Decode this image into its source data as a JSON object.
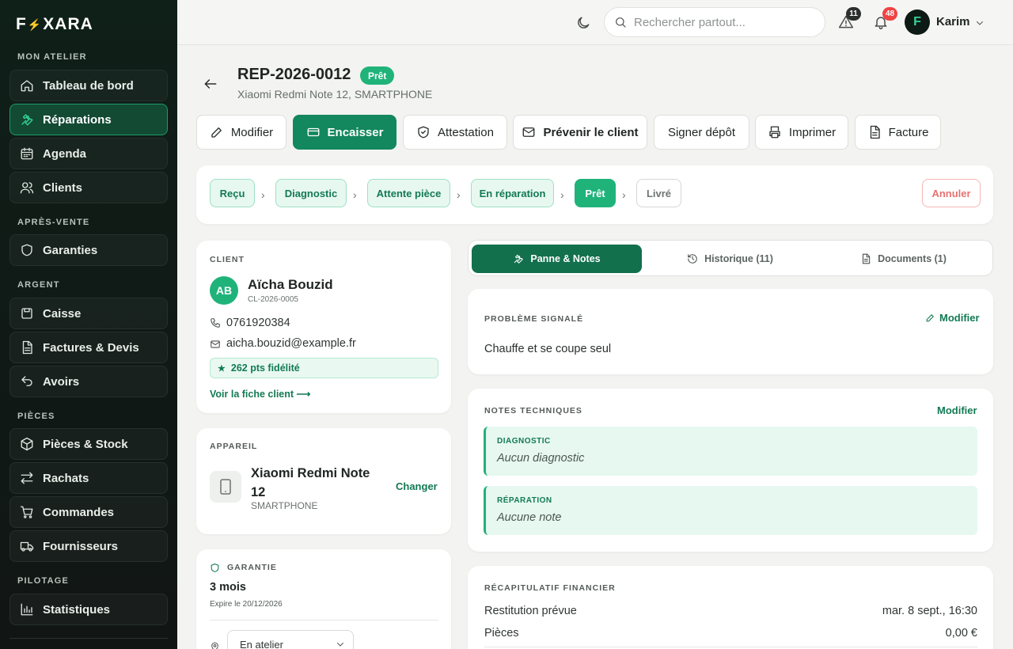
{
  "brand": {
    "logo_left": "F",
    "logo_bolt": "⚡",
    "logo_right": "XARA",
    "accent": "#1fb37a",
    "dark_accent": "#13875e"
  },
  "sidebar": {
    "sections": {
      "atelier": "MON ATELIER",
      "apres": "APRÈS-VENTE",
      "argent": "ARGENT",
      "pieces": "PIÈCES",
      "pilotage": "PILOTAGE"
    },
    "items": [
      {
        "label": "Tableau de bord",
        "icon": "home-icon"
      },
      {
        "label": "Réparations",
        "icon": "wrench-icon",
        "active": true
      },
      {
        "label": "Agenda",
        "icon": "calendar-icon"
      },
      {
        "label": "Clients",
        "icon": "users-icon"
      },
      {
        "label": "Garanties",
        "icon": "shield-icon"
      },
      {
        "label": "Caisse",
        "icon": "register-icon"
      },
      {
        "label": "Factures & Devis",
        "icon": "document-icon"
      },
      {
        "label": "Avoirs",
        "icon": "undo-icon"
      },
      {
        "label": "Pièces & Stock",
        "icon": "box-icon"
      },
      {
        "label": "Rachats",
        "icon": "swap-icon"
      },
      {
        "label": "Commandes",
        "icon": "cart-icon"
      },
      {
        "label": "Fournisseurs",
        "icon": "truck-icon"
      },
      {
        "label": "Statistiques",
        "icon": "bar-chart-icon"
      }
    ]
  },
  "topbar": {
    "search_placeholder": "Rechercher partout...",
    "alerts_count": "11",
    "notifications_count": "48",
    "user_initial": "F",
    "user_name": "Karim"
  },
  "repair": {
    "reference": "REP-2026-0012",
    "status": "Prêt",
    "device_line": "Xiaomi Redmi Note 12, SMARTPHONE"
  },
  "actions": {
    "edit": "Modifier",
    "cash_in": "Encaisser",
    "certificate": "Attestation",
    "notify": "Prévenir le client",
    "sign": "Signer dépôt",
    "print": "Imprimer",
    "invoice": "Facture"
  },
  "workflow": {
    "steps": [
      "Reçu",
      "Diagnostic",
      "Attente pièce",
      "En réparation",
      "Prêt",
      "Livré"
    ],
    "cancel": "Annuler"
  },
  "client": {
    "label": "CLIENT",
    "initials": "AB",
    "name": "Aïcha Bouzid",
    "id": "CL-2026-0005",
    "phone": "0761920384",
    "email": "aicha.bouzid@example.fr",
    "loyalty": "262 pts fidélité",
    "link": "Voir la fiche client ⟶"
  },
  "device": {
    "label": "APPAREIL",
    "name_line1": "Xiaomi Redmi Note",
    "name_line2": "12",
    "type": "SMARTPHONE",
    "change": "Changer"
  },
  "warranty": {
    "label": "GARANTIE",
    "duration": "3 mois",
    "expires": "Expire le 20/12/2026",
    "location": "En atelier"
  },
  "tabs": [
    {
      "label": "Panne & Notes"
    },
    {
      "label": "Historique (11)"
    },
    {
      "label": "Documents (1)"
    }
  ],
  "problem": {
    "label": "PROBLÈME SIGNALÉ",
    "edit": "Modifier",
    "text": "Chauffe et se coupe seul"
  },
  "notes": {
    "label": "NOTES TECHNIQUES",
    "edit": "Modifier",
    "diag_label": "DIAGNOSTIC",
    "diag_value": "Aucun diagnostic",
    "rep_label": "RÉPARATION",
    "rep_value": "Aucune note"
  },
  "finance": {
    "label": "RÉCAPITULATIF FINANCIER",
    "rows": [
      {
        "label": "Restitution prévue",
        "value": "mar. 8 sept., 16:30"
      },
      {
        "label": "Pièces",
        "value": "0,00 €"
      }
    ]
  }
}
